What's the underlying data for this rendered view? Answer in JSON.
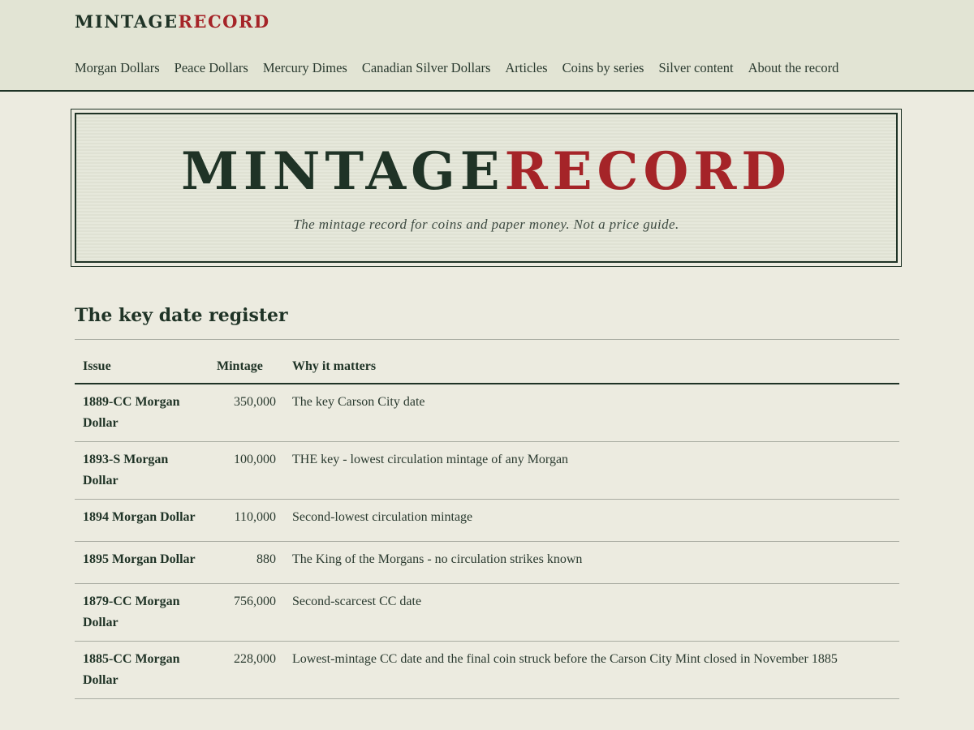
{
  "site": {
    "logo_part1": "MINTAGE",
    "logo_part2": "RECORD"
  },
  "nav": {
    "items": [
      {
        "label": "Morgan Dollars"
      },
      {
        "label": "Peace Dollars"
      },
      {
        "label": "Mercury Dimes"
      },
      {
        "label": "Canadian Silver Dollars"
      },
      {
        "label": "Articles"
      },
      {
        "label": "Coins by series"
      },
      {
        "label": "Silver content"
      },
      {
        "label": "About the record"
      }
    ]
  },
  "banner": {
    "title_part1": "MINTAGE",
    "title_part2": "RECORD",
    "tagline": "The mintage record for coins and paper money. Not a price guide."
  },
  "register": {
    "title": "The key date register",
    "columns": [
      "Issue",
      "Mintage",
      "Why it matters"
    ],
    "rows": [
      {
        "issue": "1889-CC Morgan Dollar",
        "mintage": "350,000",
        "note": "The key Carson City date"
      },
      {
        "issue": "1893-S Morgan Dollar",
        "mintage": "100,000",
        "note": "THE key - lowest circulation mintage of any Morgan"
      },
      {
        "issue": "1894 Morgan Dollar",
        "mintage": "110,000",
        "note": "Second-lowest circulation mintage"
      },
      {
        "issue": "1895 Morgan Dollar",
        "mintage": "880",
        "note": "The King of the Morgans - no circulation strikes known"
      },
      {
        "issue": "1879-CC Morgan Dollar",
        "mintage": "756,000",
        "note": "Second-scarcest CC date"
      },
      {
        "issue": "1885-CC Morgan Dollar",
        "mintage": "228,000",
        "note": "Lowest-mintage CC date and the final coin struck before the Carson City Mint closed in November 1885"
      }
    ]
  },
  "colors": {
    "brand_green": "#1f3326",
    "brand_red": "#a52428",
    "page_bg": "#ecebe0",
    "header_bg": "#e2e4d4"
  }
}
